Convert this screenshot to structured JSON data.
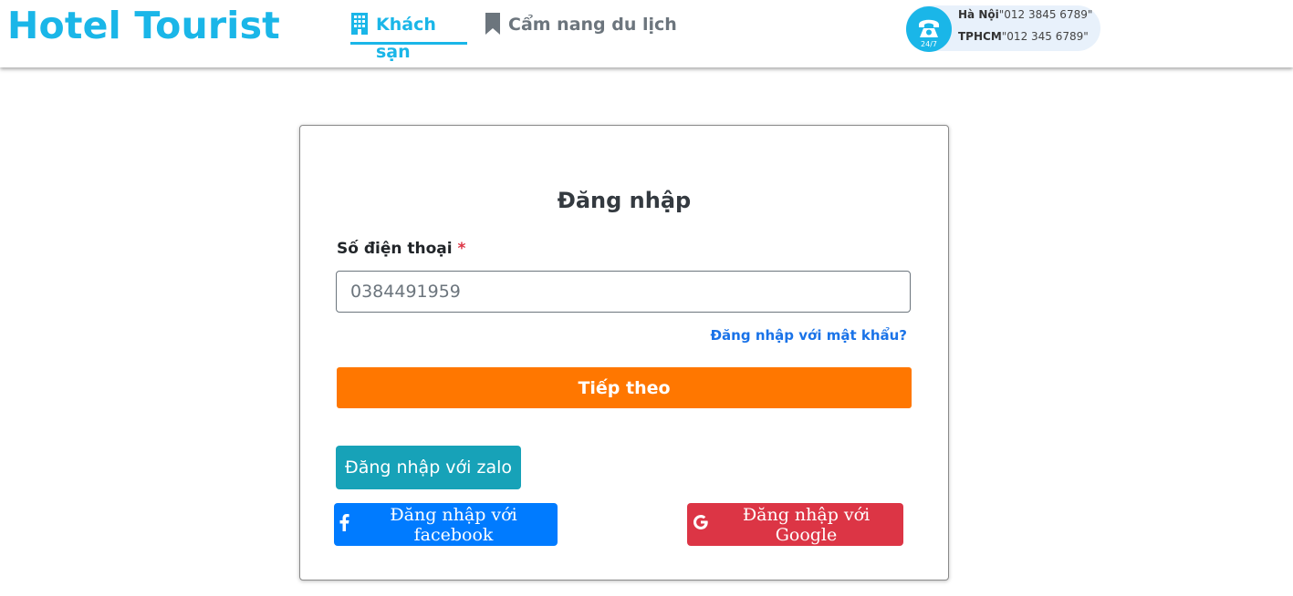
{
  "header": {
    "brand": "Hotel Tourist",
    "nav": [
      {
        "label": "Khách sạn",
        "icon": "building-icon",
        "active": true
      },
      {
        "label": "Cẩm nang du lịch",
        "icon": "bookmark-icon",
        "active": false
      }
    ],
    "hotline": {
      "icon": "phone-24-7-icon",
      "badge": "24/7",
      "lines": [
        {
          "city": "Hà Nội",
          "number": "\"012 3845 6789\""
        },
        {
          "city": "TPHCM",
          "number": "\"012 345 6789\""
        }
      ]
    }
  },
  "login": {
    "title": "Đăng nhập",
    "phone_label": "Số điện thoại",
    "required_mark": "*",
    "phone_value": "0384491959",
    "password_link": "Đăng nhập với mật khẩu?",
    "next_button": "Tiếp theo",
    "zalo_button": "Đăng nhập với zalo",
    "facebook_button": "Đăng nhập với facebook",
    "google_button": "Đăng nhập với Google"
  },
  "colors": {
    "brand": "#1ab6e8",
    "next_button": "#ff7700",
    "zalo_button": "#17a2b8",
    "facebook_button": "#007bff",
    "google_button": "#dc3545",
    "link": "#1a73e8"
  }
}
